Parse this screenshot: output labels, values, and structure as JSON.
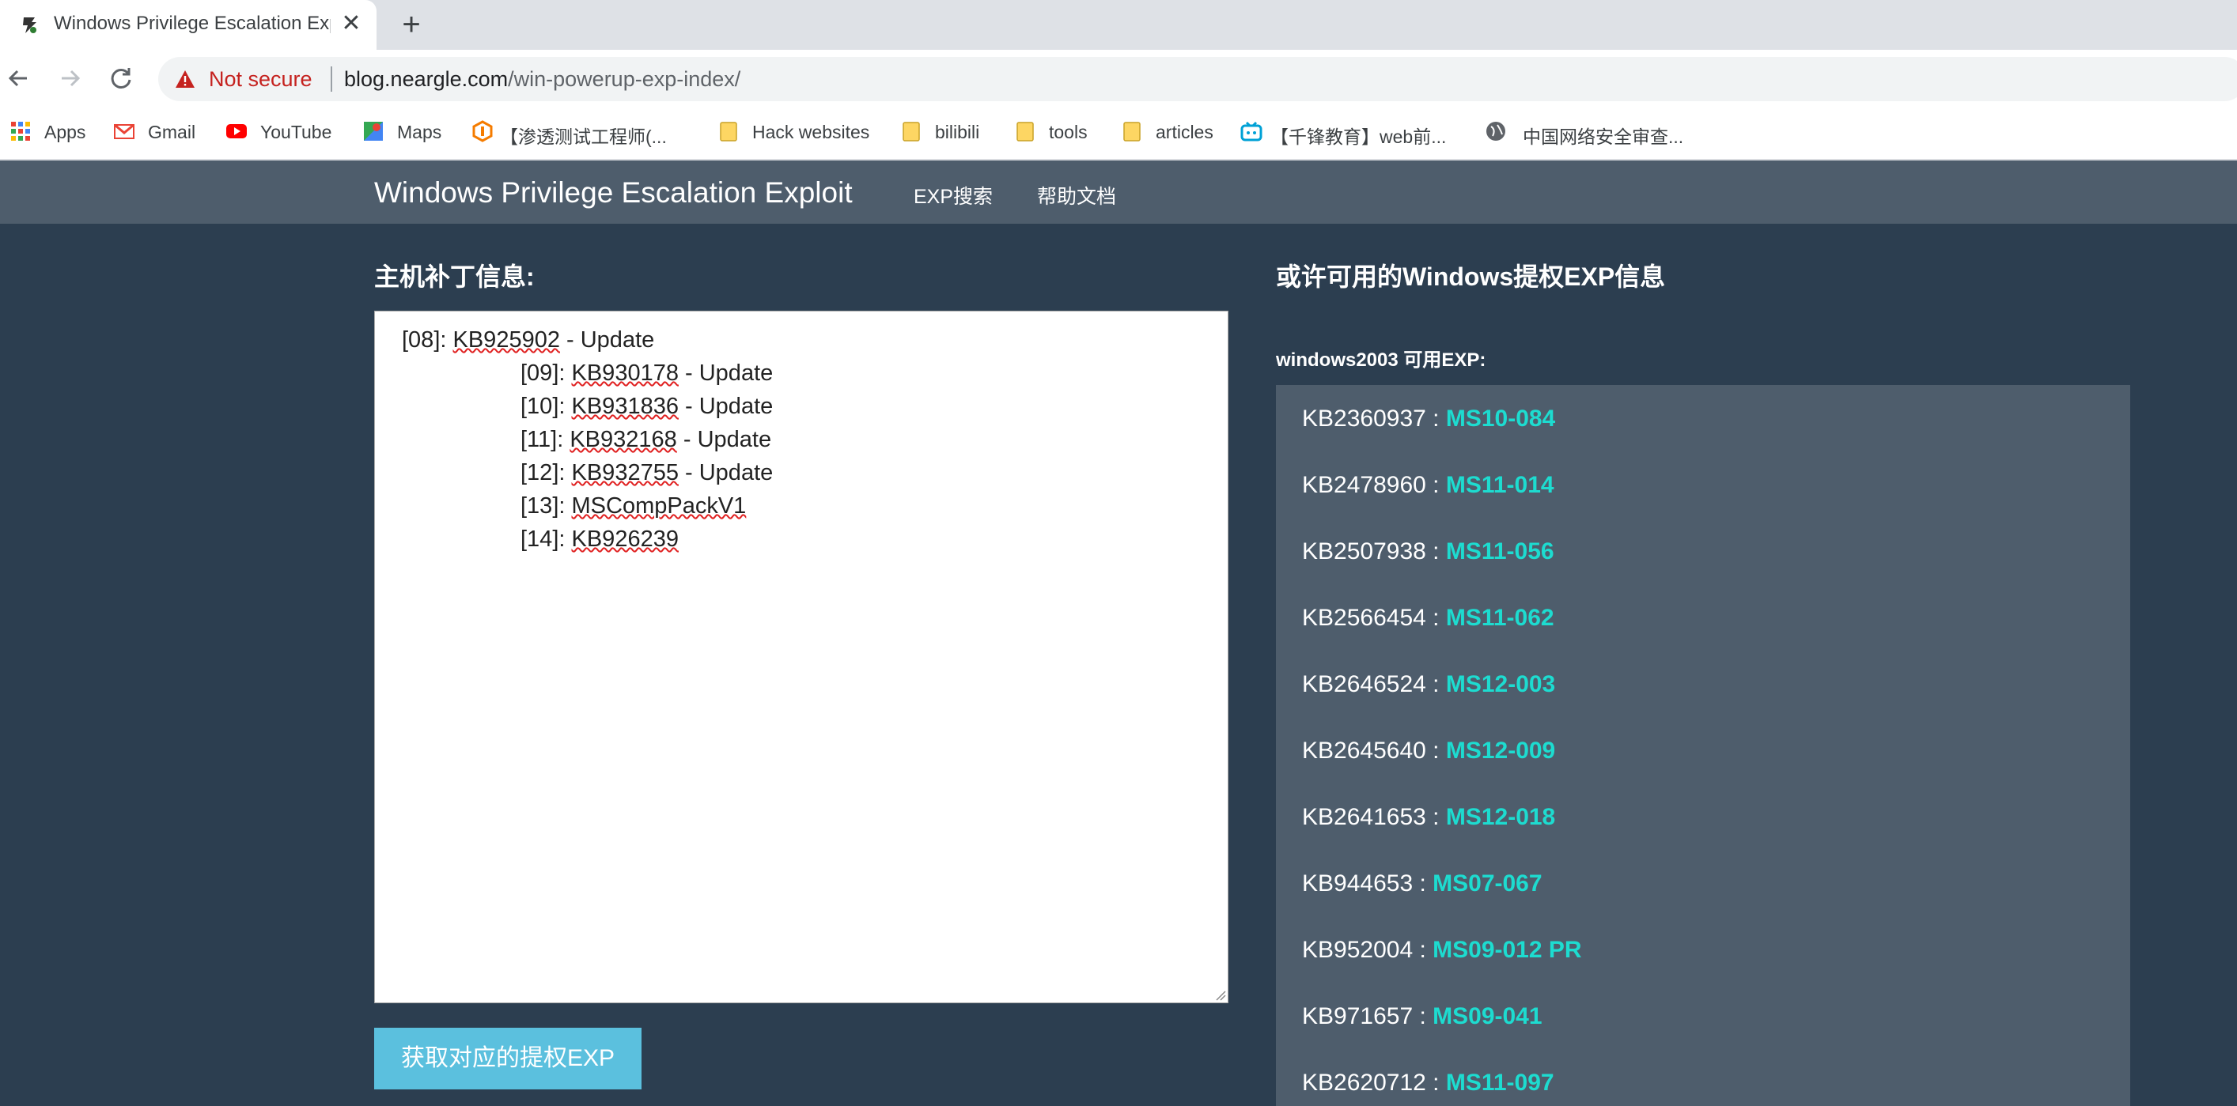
{
  "browser": {
    "tab_title": "Windows Privilege Escalation Exploit",
    "tab_close": "✕",
    "new_tab": "+",
    "security_label": "Not secure",
    "url_domain": "blog.neargle.com",
    "url_path": "/win-powerup-exp-index/",
    "bookmarks": [
      {
        "label": "Apps",
        "icon": "apps-grid-icon"
      },
      {
        "label": "Gmail",
        "icon": "gmail-icon"
      },
      {
        "label": "YouTube",
        "icon": "youtube-icon"
      },
      {
        "label": "Maps",
        "icon": "maps-icon"
      },
      {
        "label": "【渗透测试工程师(...",
        "icon": "site-icon"
      },
      {
        "label": "Hack websites",
        "icon": "folder-icon"
      },
      {
        "label": "bilibili",
        "icon": "folder-icon"
      },
      {
        "label": "tools",
        "icon": "folder-icon"
      },
      {
        "label": "articles",
        "icon": "folder-icon"
      },
      {
        "label": "【千锋教育】web前...",
        "icon": "bilibili-icon"
      },
      {
        "label": "中国网络安全审查...",
        "icon": "globe-icon"
      }
    ]
  },
  "site": {
    "brand": "Windows Privilege Escalation Exploit",
    "nav": [
      "EXP搜索",
      "帮助文档"
    ],
    "patch_section_title": "主机补丁信息:",
    "exp_section_title": "或许可用的Windows提权EXP信息",
    "patch_lines": [
      {
        "prefix": "[08]: ",
        "kb": "KB925902",
        "suffix": " - Update"
      },
      {
        "prefix": "[09]: ",
        "kb": "KB930178",
        "suffix": " - Update"
      },
      {
        "prefix": "[10]: ",
        "kb": "KB931836",
        "suffix": " - Update"
      },
      {
        "prefix": "[11]: ",
        "kb": "KB932168",
        "suffix": " - Update"
      },
      {
        "prefix": "[12]: ",
        "kb": "KB932755",
        "suffix": " - Update"
      },
      {
        "prefix": "[13]: ",
        "kb": "MSCompPackV1",
        "suffix": ""
      },
      {
        "prefix": "[14]: ",
        "kb": "KB926239",
        "suffix": ""
      }
    ],
    "submit_button": "获取对应的提权EXP",
    "system_label": "windows2003 可用EXP:",
    "exp_list": [
      {
        "kb": "KB2360937 : ",
        "ms": "MS10-084"
      },
      {
        "kb": "KB2478960 : ",
        "ms": "MS11-014"
      },
      {
        "kb": "KB2507938 : ",
        "ms": "MS11-056"
      },
      {
        "kb": "KB2566454 : ",
        "ms": "MS11-062"
      },
      {
        "kb": "KB2646524 : ",
        "ms": "MS12-003"
      },
      {
        "kb": "KB2645640 : ",
        "ms": "MS12-009"
      },
      {
        "kb": "KB2641653 : ",
        "ms": "MS12-018"
      },
      {
        "kb": "KB944653 : ",
        "ms": "MS07-067"
      },
      {
        "kb": "KB952004 : ",
        "ms": "MS09-012 PR"
      },
      {
        "kb": "KB971657 : ",
        "ms": "MS09-041"
      },
      {
        "kb": "KB2620712 : ",
        "ms": "MS11-097"
      }
    ]
  },
  "colors": {
    "page_bg": "#2c3e50",
    "navbar_bg": "#4e5d6c",
    "button_bg": "#5bc0de",
    "ms_link": "#1ddcd0",
    "not_secure": "#c5221f"
  }
}
